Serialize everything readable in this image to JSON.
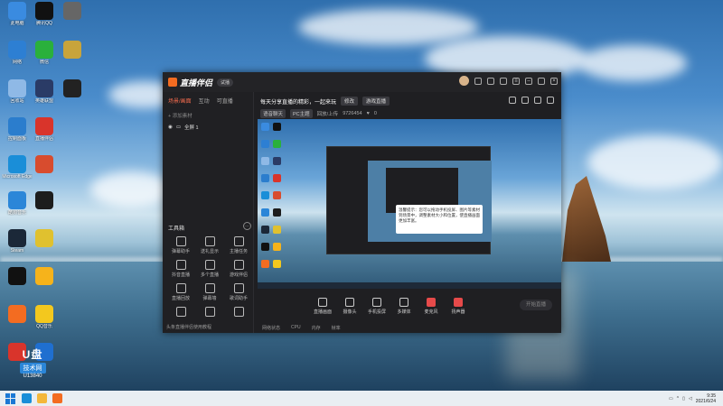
{
  "desktop": {
    "icons": [
      {
        "label": "此电脑",
        "color": "#3a8be0"
      },
      {
        "label": "腾讯QQ",
        "color": "#111111"
      },
      {
        "label": "",
        "color": "#666666"
      },
      {
        "label": "网络",
        "color": "#2d7fd3"
      },
      {
        "label": "微信",
        "color": "#2ab03c"
      },
      {
        "label": "",
        "color": "#c8a43b"
      },
      {
        "label": "回收站",
        "color": "#8fb9e6"
      },
      {
        "label": "英雄联盟",
        "color": "#2a3b66"
      },
      {
        "label": "",
        "color": "#222222"
      },
      {
        "label": "控制面板",
        "color": "#2b7dcd"
      },
      {
        "label": "直播伴侣",
        "color": "#d9342b"
      },
      {
        "label": "Microsoft Edge",
        "color": "#1a8ed8"
      },
      {
        "label": "",
        "color": "#d84c2e"
      },
      {
        "label": "酷狗音乐",
        "color": "#2b86d8"
      },
      {
        "label": "",
        "color": "#1d1d1d"
      },
      {
        "label": "Steam",
        "color": "#1b2838"
      },
      {
        "label": "",
        "color": "#e0c12f"
      },
      {
        "label": "",
        "color": "#111111"
      },
      {
        "label": "",
        "color": "#f6b31b"
      },
      {
        "label": "",
        "color": "#f36c21"
      },
      {
        "label": "QQ音乐",
        "color": "#f3c81e"
      },
      {
        "label": "",
        "color": "#d9342b"
      },
      {
        "label": "",
        "color": "#1f6fd0"
      }
    ]
  },
  "window": {
    "title": "直播伴侣",
    "version": "试播",
    "left": {
      "tabs": [
        "场景/画面",
        "互动",
        "可直播"
      ],
      "add_scene": "添加素材",
      "scene_name": "全屏 1",
      "tools_title": "工具箱",
      "tools": [
        "弹幕助手",
        "送礼显示",
        "主播任务",
        "抖音直播",
        "多个直播",
        "游戏伴侣",
        "直播回放",
        "弹幕墙",
        "歌词助手",
        "",
        "",
        ""
      ],
      "status": "头条直播伴侣使用教程"
    },
    "right": {
      "title_text": "每天分享直播的精彩，一起来玩",
      "title_btn": "修改",
      "topic": "游戏直播",
      "sub_tags": [
        "语音聊天",
        "PC主题"
      ],
      "sub_text": "回放/上传",
      "viewer_count": "9726454",
      "likes": "0",
      "controls": [
        "直播画面",
        "摄像头",
        "手机投屏",
        "多媒体",
        "麦克风",
        "扬声器"
      ],
      "go_live": "开始直播",
      "status_items": [
        "网络状态",
        "CPU",
        "内存",
        "帧率"
      ],
      "tooltip": "温馨提示：您可以拖动手机投屏、图片等素材到场景中，调整素材大小和位置，使直播画面更加丰富。"
    }
  },
  "badge": {
    "line1": "U盘",
    "line2": "技术网",
    "line3": "U13840"
  },
  "taskbar": {
    "time": "9:35",
    "date": "2021/6/24"
  }
}
